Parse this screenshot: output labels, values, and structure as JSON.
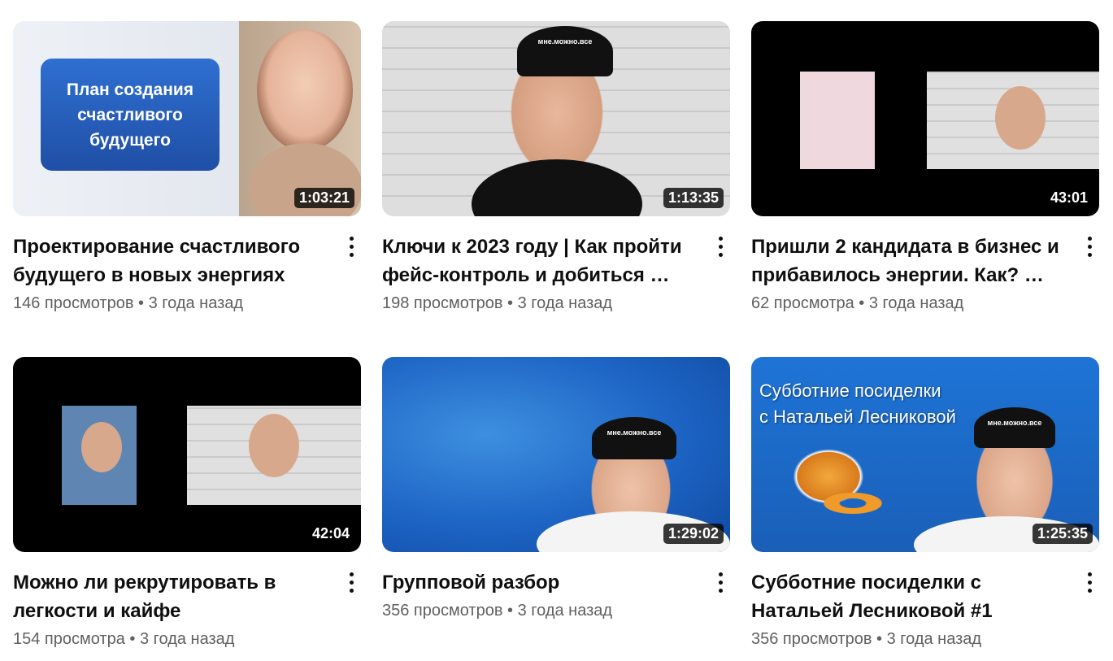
{
  "videos": [
    {
      "title": "Проектирование счастливого будущего в новых энергиях",
      "views": "146 просмотров",
      "age": "3 года назад",
      "duration": "1:03:21",
      "thumb_text": "План создания счастливого будущего"
    },
    {
      "title": "Ключи к 2023 году | Как пройти фейс-контроль и добиться …",
      "views": "198 просмотров",
      "age": "3 года назад",
      "duration": "1:13:35",
      "cap_text": "мне.можно.все"
    },
    {
      "title": "Пришли 2 кандидата в бизнес и прибавилось энергии. Как? …",
      "views": "62 просмотра",
      "age": "3 года назад",
      "duration": "43:01"
    },
    {
      "title": "Можно ли рекрутировать в легкости и кайфе",
      "views": "154 просмотра",
      "age": "3 года назад",
      "duration": "42:04"
    },
    {
      "title": "Групповой разбор",
      "views": "356 просмотров",
      "age": "3 года назад",
      "duration": "1:29:02",
      "cap_text": "мне.можно.все"
    },
    {
      "title": "Субботние посиделки с Натальей Лесниковой #1",
      "views": "356 просмотров",
      "age": "3 года назад",
      "duration": "1:25:35",
      "thumb_text_line1": "Субботние посиделки",
      "thumb_text_line2": "с Натальей Лесниковой",
      "cap_text": "мне.можно.все"
    }
  ],
  "separator": "•"
}
